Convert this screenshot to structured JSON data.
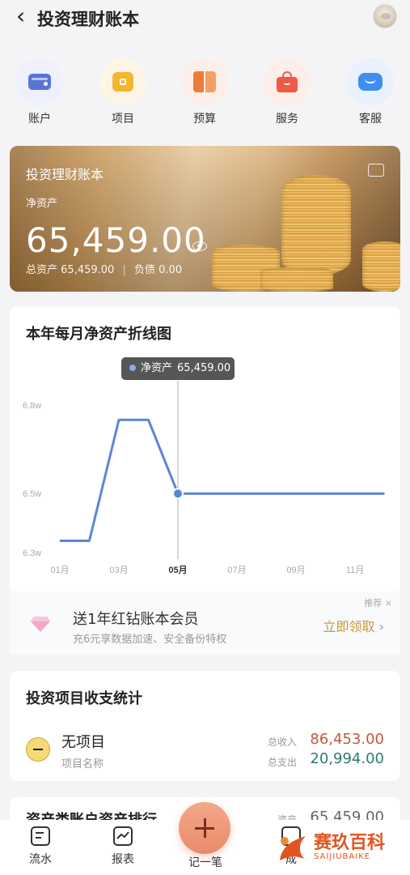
{
  "header": {
    "title": "投资理财账本"
  },
  "quick_actions": [
    {
      "label": "账户",
      "icon": "wallet-icon"
    },
    {
      "label": "项目",
      "icon": "folder-icon"
    },
    {
      "label": "预算",
      "icon": "budget-book-icon"
    },
    {
      "label": "服务",
      "icon": "shopping-bag-icon"
    },
    {
      "label": "客服",
      "icon": "chat-bubble-icon"
    }
  ],
  "banner": {
    "title": "投资理财账本",
    "net_label": "净资产",
    "net_value": "65,459.00",
    "total_label": "总资产",
    "total_value": "65,459.00",
    "debt_label": "负债",
    "debt_value": "0.00"
  },
  "chart_card": {
    "title": "本年每月净资产折线图",
    "tooltip_label": "净资产",
    "tooltip_value": "65,459.00"
  },
  "chart_data": {
    "type": "line",
    "title": "本年每月净资产折线图",
    "x": [
      "01月",
      "02月",
      "03月",
      "04月",
      "05月",
      "06月",
      "07月",
      "08月",
      "09月",
      "10月",
      "11月",
      "12月"
    ],
    "x_tick_labels": [
      "01月",
      "03月",
      "05月",
      "07月",
      "09月",
      "11月"
    ],
    "y_tick_labels": [
      "6.3w",
      "6.5w",
      "6.8w"
    ],
    "ylim": [
      6.3,
      6.8
    ],
    "series": [
      {
        "values": [
          6.34,
          6.34,
          6.75,
          6.75,
          6.5,
          6.5,
          6.5,
          6.5,
          6.5,
          6.5,
          6.5,
          6.5
        ]
      }
    ],
    "highlight_index": 4,
    "grid": false,
    "color": "#5b86d6"
  },
  "promo": {
    "title": "送1年红钻账本会员",
    "subtitle": "充6元享数据加速、安全备份特权",
    "cta": "立即领取",
    "tag": "推荐"
  },
  "project_card": {
    "title": "投资项目收支统计",
    "name": "无项目",
    "name_sub": "项目名称",
    "income_label": "总收入",
    "income_value": "86,453.00",
    "expense_label": "总支出",
    "expense_value": "20,994.00"
  },
  "partial_card": {
    "title": "资产类账户资产排行",
    "right_label": "资产",
    "right_value": "65,459.00"
  },
  "tabbar": {
    "items": [
      {
        "label": "流水",
        "icon": "receipt-icon"
      },
      {
        "label": "报表",
        "icon": "report-icon"
      },
      {
        "label": "记一笔",
        "icon": "plus-icon"
      },
      {
        "label": "成",
        "icon": "asset-icon"
      }
    ]
  },
  "watermark": {
    "main": "赛玖百科",
    "sub": "SAIJIUBAIKE"
  },
  "colors": {
    "accent": "#5b86d6",
    "income": "#c05a3a",
    "expense": "#2d7a73",
    "gold": "#c89a3b",
    "fab": "#e98b6a"
  }
}
